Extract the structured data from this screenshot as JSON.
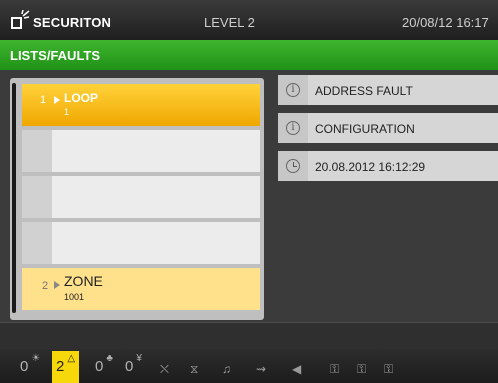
{
  "header": {
    "brand": "SECURITON",
    "level": "LEVEL 2",
    "datetime": "20/08/12 16:17"
  },
  "title": "LISTS/FAULTS",
  "list": {
    "items": [
      {
        "index": "1",
        "name": "LOOP",
        "sub": "1"
      },
      {
        "index": "2",
        "name": "ZONE",
        "sub": "1001"
      }
    ]
  },
  "details": [
    {
      "icon": "info-icon",
      "text": "ADDRESS FAULT"
    },
    {
      "icon": "info-icon",
      "text": "CONFIGURATION"
    },
    {
      "icon": "clock-icon",
      "text": "20.08.2012 16:12:29"
    }
  ],
  "counters": [
    {
      "icon": "fire-alarm-icon",
      "value": "0"
    },
    {
      "icon": "fault-warning-icon",
      "value": "2"
    },
    {
      "icon": "pre-alarm-icon",
      "value": "0"
    },
    {
      "icon": "disabled-icon",
      "value": "0"
    }
  ]
}
